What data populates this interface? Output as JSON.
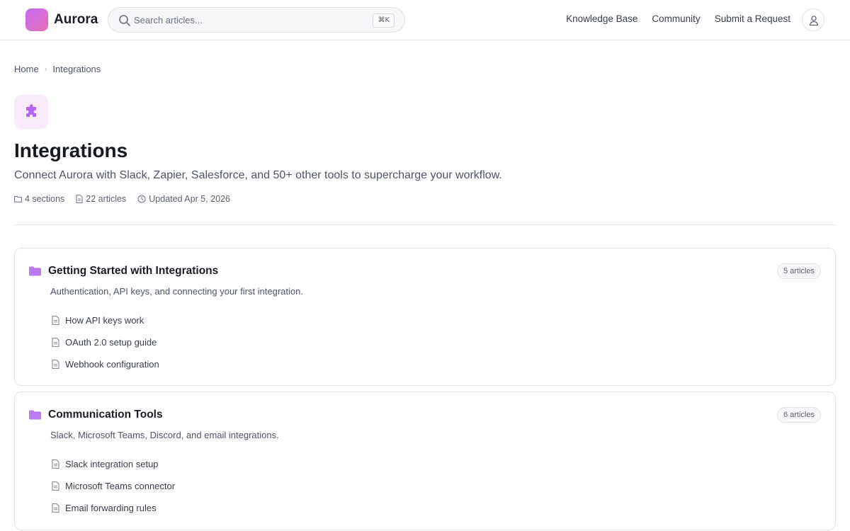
{
  "header": {
    "brand": "Aurora",
    "search_placeholder": "Search articles...",
    "search_shortcut": "⌘K",
    "nav": [
      "Knowledge Base",
      "Community",
      "Submit a Request"
    ]
  },
  "breadcrumb": [
    "Home",
    "Integrations"
  ],
  "category": {
    "title": "Integrations",
    "description": "Connect Aurora with Slack, Zapier, Salesforce, and 50+ other tools to supercharge your workflow.",
    "sections_count": "4 sections",
    "articles_count": "22 articles",
    "updated": "Updated Apr 5, 2026"
  },
  "sections": [
    {
      "title": "Getting Started with Integrations",
      "badge": "5 articles",
      "description": "Authentication, API keys, and connecting your first integration.",
      "articles": [
        "How API keys work",
        "OAuth 2.0 setup guide",
        "Webhook configuration"
      ]
    },
    {
      "title": "Communication Tools",
      "badge": "6 articles",
      "description": "Slack, Microsoft Teams, Discord, and email integrations.",
      "articles": [
        "Slack integration setup",
        "Microsoft Teams connector",
        "Email forwarding rules"
      ]
    }
  ],
  "colors": {
    "accent": "#b565f0",
    "accent_soft": "#f8ecfb",
    "border": "#e3e5ea"
  }
}
